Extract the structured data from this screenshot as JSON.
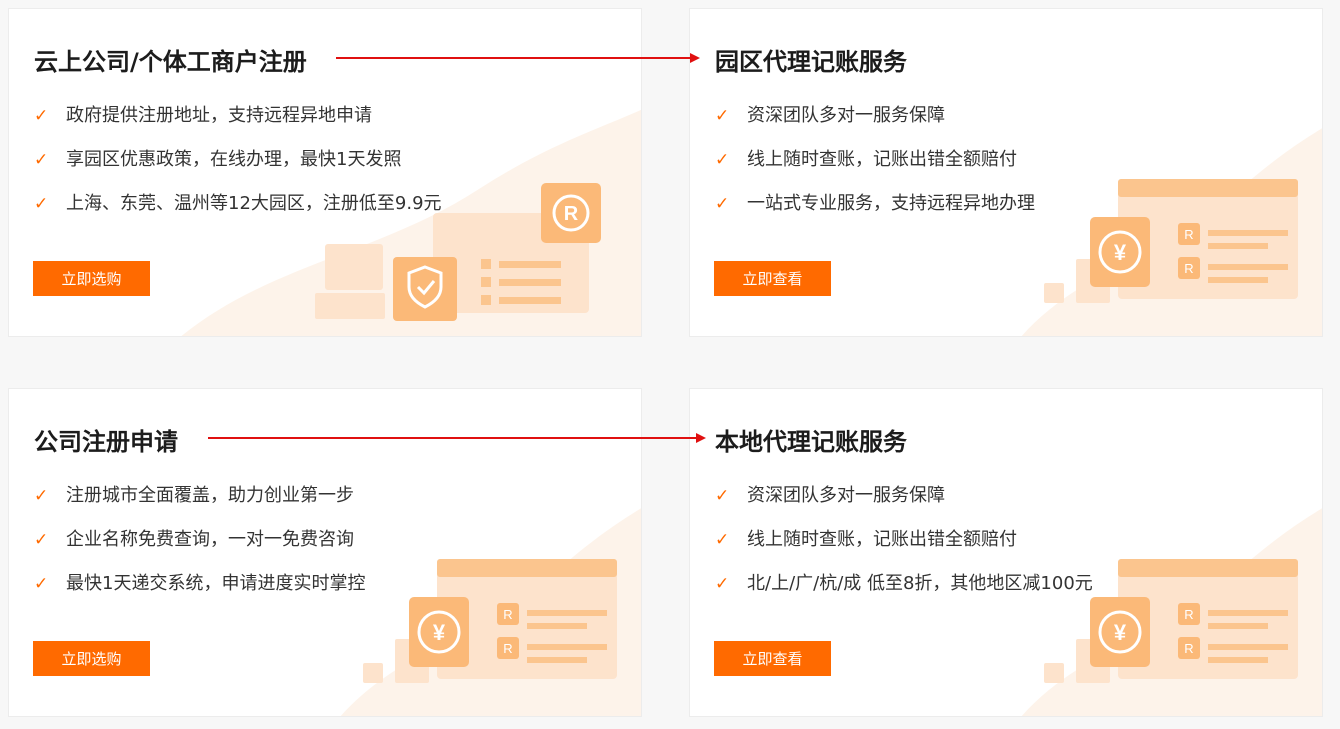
{
  "cards": [
    {
      "title": "云上公司/个体工商户注册",
      "features": [
        "政府提供注册地址，支持远程异地申请",
        "享园区优惠政策，在线办理，最快1天发照",
        "上海、东莞、温州等12大园区，注册低至9.9元"
      ],
      "button": "立即选购",
      "illustration": "registration-shield-icon"
    },
    {
      "title": "园区代理记账服务",
      "features": [
        "资深团队多对一服务保障",
        "线上随时查账，记账出错全额赔付",
        "一站式专业服务，支持远程异地办理"
      ],
      "button": "立即查看",
      "illustration": "yuan-ledger-icon"
    },
    {
      "title": "公司注册申请",
      "features": [
        "注册城市全面覆盖，助力创业第一步",
        "企业名称免费查询，一对一免费咨询",
        "最快1天递交系统，申请进度实时掌控"
      ],
      "button": "立即选购",
      "illustration": "yuan-ledger-icon"
    },
    {
      "title": "本地代理记账服务",
      "features": [
        "资深团队多对一服务保障",
        "线上随时查账，记账出错全额赔付",
        "北/上/广/杭/成 低至8折，其他地区减100元"
      ],
      "button": "立即查看",
      "illustration": "yuan-ledger-icon"
    }
  ],
  "icons": {
    "check": "✓",
    "registered": "®",
    "yuan": "¥",
    "r_letter": "R"
  },
  "colors": {
    "accent": "#ff6a00",
    "arrow": "#e01010",
    "illustration_light": "#fde3cc",
    "illustration_mid": "#fbb978"
  }
}
